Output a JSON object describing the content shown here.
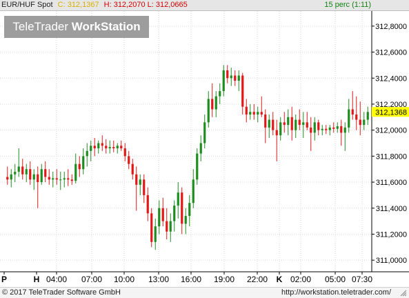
{
  "header": {
    "symbol": "EUR/HUF Spot",
    "close": "C: 312,1367",
    "high": "H: 312,2070",
    "low": "L: 312,0665",
    "period": "15 perc (1:11)"
  },
  "logo": {
    "part1": "TeleTrader",
    "part2": "WorkStation"
  },
  "footer": {
    "copyright": "© 2017 TeleTrader Software GmbH",
    "website": "http://workstation.teletrader.com/"
  },
  "colors": {
    "up": "#1e8c1e",
    "down": "#e01818",
    "grid": "#d9d9d9",
    "price_tag": "#ffff00",
    "header_bg": "#e6e6e6"
  },
  "chart_data": {
    "type": "candlestick",
    "price_tag": "312,1368",
    "ylim": [
      310.9,
      312.9
    ],
    "y_ticks": [
      "311,0000",
      "311,2000",
      "311,4000",
      "311,6000",
      "311,8000",
      "312,0000",
      "312,2000",
      "312,4000",
      "312,6000",
      "312,8000"
    ],
    "y_tick_values": [
      311.0,
      311.2,
      311.4,
      311.6,
      311.8,
      312.0,
      312.2,
      312.4,
      312.6,
      312.8
    ],
    "x_ticks": [
      "P",
      "H",
      "04:00",
      "07:00",
      "10:00",
      "13:00",
      "16:00",
      "19:00",
      "22:00",
      "K",
      "02:00",
      "05:00",
      "07:30"
    ],
    "candles": [
      {
        "o": 311.64,
        "h": 311.72,
        "l": 311.58,
        "c": 311.62
      },
      {
        "o": 311.62,
        "h": 311.7,
        "l": 311.56,
        "c": 311.66
      },
      {
        "o": 311.66,
        "h": 311.74,
        "l": 311.6,
        "c": 311.68
      },
      {
        "o": 311.68,
        "h": 311.86,
        "l": 311.64,
        "c": 311.72
      },
      {
        "o": 311.72,
        "h": 311.78,
        "l": 311.62,
        "c": 311.66
      },
      {
        "o": 311.66,
        "h": 311.74,
        "l": 311.6,
        "c": 311.7
      },
      {
        "o": 311.7,
        "h": 311.76,
        "l": 311.58,
        "c": 311.62
      },
      {
        "o": 311.62,
        "h": 311.7,
        "l": 311.54,
        "c": 311.66
      },
      {
        "o": 311.66,
        "h": 311.72,
        "l": 311.4,
        "c": 311.6
      },
      {
        "o": 311.6,
        "h": 311.74,
        "l": 311.58,
        "c": 311.7
      },
      {
        "o": 311.7,
        "h": 311.76,
        "l": 311.6,
        "c": 311.64
      },
      {
        "o": 311.64,
        "h": 311.7,
        "l": 311.58,
        "c": 311.62
      },
      {
        "o": 311.62,
        "h": 311.68,
        "l": 311.56,
        "c": 311.63
      },
      {
        "o": 311.63,
        "h": 311.7,
        "l": 311.58,
        "c": 311.62
      },
      {
        "o": 311.62,
        "h": 311.68,
        "l": 311.54,
        "c": 311.62
      },
      {
        "o": 311.62,
        "h": 311.68,
        "l": 311.56,
        "c": 311.63
      },
      {
        "o": 311.63,
        "h": 311.7,
        "l": 311.57,
        "c": 311.62
      },
      {
        "o": 311.62,
        "h": 311.66,
        "l": 311.58,
        "c": 311.61
      },
      {
        "o": 311.61,
        "h": 311.82,
        "l": 311.59,
        "c": 311.74
      },
      {
        "o": 311.74,
        "h": 311.8,
        "l": 311.64,
        "c": 311.7
      },
      {
        "o": 311.7,
        "h": 311.86,
        "l": 311.66,
        "c": 311.8
      },
      {
        "o": 311.8,
        "h": 311.9,
        "l": 311.72,
        "c": 311.84
      },
      {
        "o": 311.84,
        "h": 311.92,
        "l": 311.76,
        "c": 311.88
      },
      {
        "o": 311.88,
        "h": 311.94,
        "l": 311.8,
        "c": 311.86
      },
      {
        "o": 311.86,
        "h": 311.92,
        "l": 311.82,
        "c": 311.9
      },
      {
        "o": 311.9,
        "h": 311.96,
        "l": 311.84,
        "c": 311.88
      },
      {
        "o": 311.88,
        "h": 311.93,
        "l": 311.82,
        "c": 311.86
      },
      {
        "o": 311.86,
        "h": 311.92,
        "l": 311.82,
        "c": 311.87
      },
      {
        "o": 311.87,
        "h": 311.92,
        "l": 311.83,
        "c": 311.86
      },
      {
        "o": 311.86,
        "h": 311.9,
        "l": 311.82,
        "c": 311.88
      },
      {
        "o": 311.88,
        "h": 311.92,
        "l": 311.84,
        "c": 311.86
      },
      {
        "o": 311.86,
        "h": 311.9,
        "l": 311.76,
        "c": 311.8
      },
      {
        "o": 311.8,
        "h": 311.84,
        "l": 311.7,
        "c": 311.74
      },
      {
        "o": 311.74,
        "h": 311.78,
        "l": 311.62,
        "c": 311.66
      },
      {
        "o": 311.66,
        "h": 311.72,
        "l": 311.38,
        "c": 311.58
      },
      {
        "o": 311.58,
        "h": 311.66,
        "l": 311.5,
        "c": 311.62
      },
      {
        "o": 311.62,
        "h": 311.66,
        "l": 311.44,
        "c": 311.5
      },
      {
        "o": 311.5,
        "h": 311.56,
        "l": 311.3,
        "c": 311.36
      },
      {
        "o": 311.36,
        "h": 311.4,
        "l": 311.1,
        "c": 311.14
      },
      {
        "o": 311.14,
        "h": 311.32,
        "l": 311.08,
        "c": 311.26
      },
      {
        "o": 311.26,
        "h": 311.46,
        "l": 311.2,
        "c": 311.4
      },
      {
        "o": 311.4,
        "h": 311.48,
        "l": 311.26,
        "c": 311.3
      },
      {
        "o": 311.3,
        "h": 311.4,
        "l": 311.16,
        "c": 311.22
      },
      {
        "o": 311.22,
        "h": 311.36,
        "l": 311.14,
        "c": 311.3
      },
      {
        "o": 311.3,
        "h": 311.46,
        "l": 311.22,
        "c": 311.42
      },
      {
        "o": 311.42,
        "h": 311.6,
        "l": 311.32,
        "c": 311.52
      },
      {
        "o": 311.52,
        "h": 311.56,
        "l": 311.2,
        "c": 311.28
      },
      {
        "o": 311.28,
        "h": 311.4,
        "l": 311.2,
        "c": 311.34
      },
      {
        "o": 311.34,
        "h": 311.5,
        "l": 311.26,
        "c": 311.44
      },
      {
        "o": 311.44,
        "h": 311.7,
        "l": 311.4,
        "c": 311.62
      },
      {
        "o": 311.62,
        "h": 311.86,
        "l": 311.58,
        "c": 311.82
      },
      {
        "o": 311.82,
        "h": 311.96,
        "l": 311.76,
        "c": 311.9
      },
      {
        "o": 311.9,
        "h": 312.12,
        "l": 311.86,
        "c": 312.06
      },
      {
        "o": 312.06,
        "h": 312.3,
        "l": 312.02,
        "c": 312.24
      },
      {
        "o": 312.24,
        "h": 312.36,
        "l": 312.1,
        "c": 312.16
      },
      {
        "o": 312.16,
        "h": 312.3,
        "l": 312.1,
        "c": 312.26
      },
      {
        "o": 312.26,
        "h": 312.36,
        "l": 312.2,
        "c": 312.3
      },
      {
        "o": 312.3,
        "h": 312.5,
        "l": 312.26,
        "c": 312.46
      },
      {
        "o": 312.46,
        "h": 312.5,
        "l": 312.36,
        "c": 312.4
      },
      {
        "o": 312.4,
        "h": 312.48,
        "l": 312.34,
        "c": 312.42
      },
      {
        "o": 312.42,
        "h": 312.46,
        "l": 312.34,
        "c": 312.38
      },
      {
        "o": 312.38,
        "h": 312.46,
        "l": 312.3,
        "c": 312.42
      },
      {
        "o": 312.42,
        "h": 312.44,
        "l": 312.12,
        "c": 312.18
      },
      {
        "o": 312.18,
        "h": 312.24,
        "l": 312.06,
        "c": 312.12
      },
      {
        "o": 312.12,
        "h": 312.2,
        "l": 312.08,
        "c": 312.14
      },
      {
        "o": 312.14,
        "h": 312.2,
        "l": 312.08,
        "c": 312.12
      },
      {
        "o": 312.12,
        "h": 312.18,
        "l": 312.06,
        "c": 312.14
      },
      {
        "o": 312.14,
        "h": 312.26,
        "l": 312.1,
        "c": 312.12
      },
      {
        "o": 312.12,
        "h": 312.16,
        "l": 311.9,
        "c": 312.02
      },
      {
        "o": 312.02,
        "h": 312.12,
        "l": 311.94,
        "c": 312.08
      },
      {
        "o": 312.08,
        "h": 312.14,
        "l": 311.96,
        "c": 312.0
      },
      {
        "o": 312.0,
        "h": 312.08,
        "l": 311.76,
        "c": 311.96
      },
      {
        "o": 311.96,
        "h": 312.1,
        "l": 311.92,
        "c": 312.06
      },
      {
        "o": 312.06,
        "h": 312.14,
        "l": 311.98,
        "c": 312.04
      },
      {
        "o": 312.04,
        "h": 312.16,
        "l": 311.96,
        "c": 312.1
      },
      {
        "o": 312.1,
        "h": 312.18,
        "l": 311.92,
        "c": 312.0
      },
      {
        "o": 312.0,
        "h": 312.12,
        "l": 311.94,
        "c": 312.08
      },
      {
        "o": 312.08,
        "h": 312.16,
        "l": 312.0,
        "c": 312.04
      },
      {
        "o": 312.04,
        "h": 312.14,
        "l": 311.94,
        "c": 312.06
      },
      {
        "o": 312.06,
        "h": 312.14,
        "l": 312.0,
        "c": 312.02
      },
      {
        "o": 312.02,
        "h": 312.1,
        "l": 311.84,
        "c": 311.98
      },
      {
        "o": 311.98,
        "h": 312.1,
        "l": 311.92,
        "c": 312.06
      },
      {
        "o": 312.06,
        "h": 312.08,
        "l": 311.96,
        "c": 312.0
      },
      {
        "o": 312.0,
        "h": 312.04,
        "l": 311.96,
        "c": 312.01
      },
      {
        "o": 312.01,
        "h": 312.04,
        "l": 311.97,
        "c": 312.0
      },
      {
        "o": 312.0,
        "h": 312.04,
        "l": 311.96,
        "c": 312.02
      },
      {
        "o": 312.02,
        "h": 312.06,
        "l": 311.98,
        "c": 312.01
      },
      {
        "o": 312.01,
        "h": 312.06,
        "l": 311.98,
        "c": 312.03
      },
      {
        "o": 312.03,
        "h": 312.08,
        "l": 311.88,
        "c": 311.98
      },
      {
        "o": 311.98,
        "h": 312.06,
        "l": 311.84,
        "c": 312.02
      },
      {
        "o": 312.02,
        "h": 312.24,
        "l": 311.98,
        "c": 312.16
      },
      {
        "o": 312.16,
        "h": 312.3,
        "l": 312.08,
        "c": 312.12
      },
      {
        "o": 312.12,
        "h": 312.26,
        "l": 312.0,
        "c": 312.08
      },
      {
        "o": 312.08,
        "h": 312.22,
        "l": 311.96,
        "c": 312.04
      },
      {
        "o": 312.04,
        "h": 312.14,
        "l": 312.0,
        "c": 312.08
      },
      {
        "o": 312.08,
        "h": 312.18,
        "l": 312.04,
        "c": 312.14
      }
    ]
  }
}
